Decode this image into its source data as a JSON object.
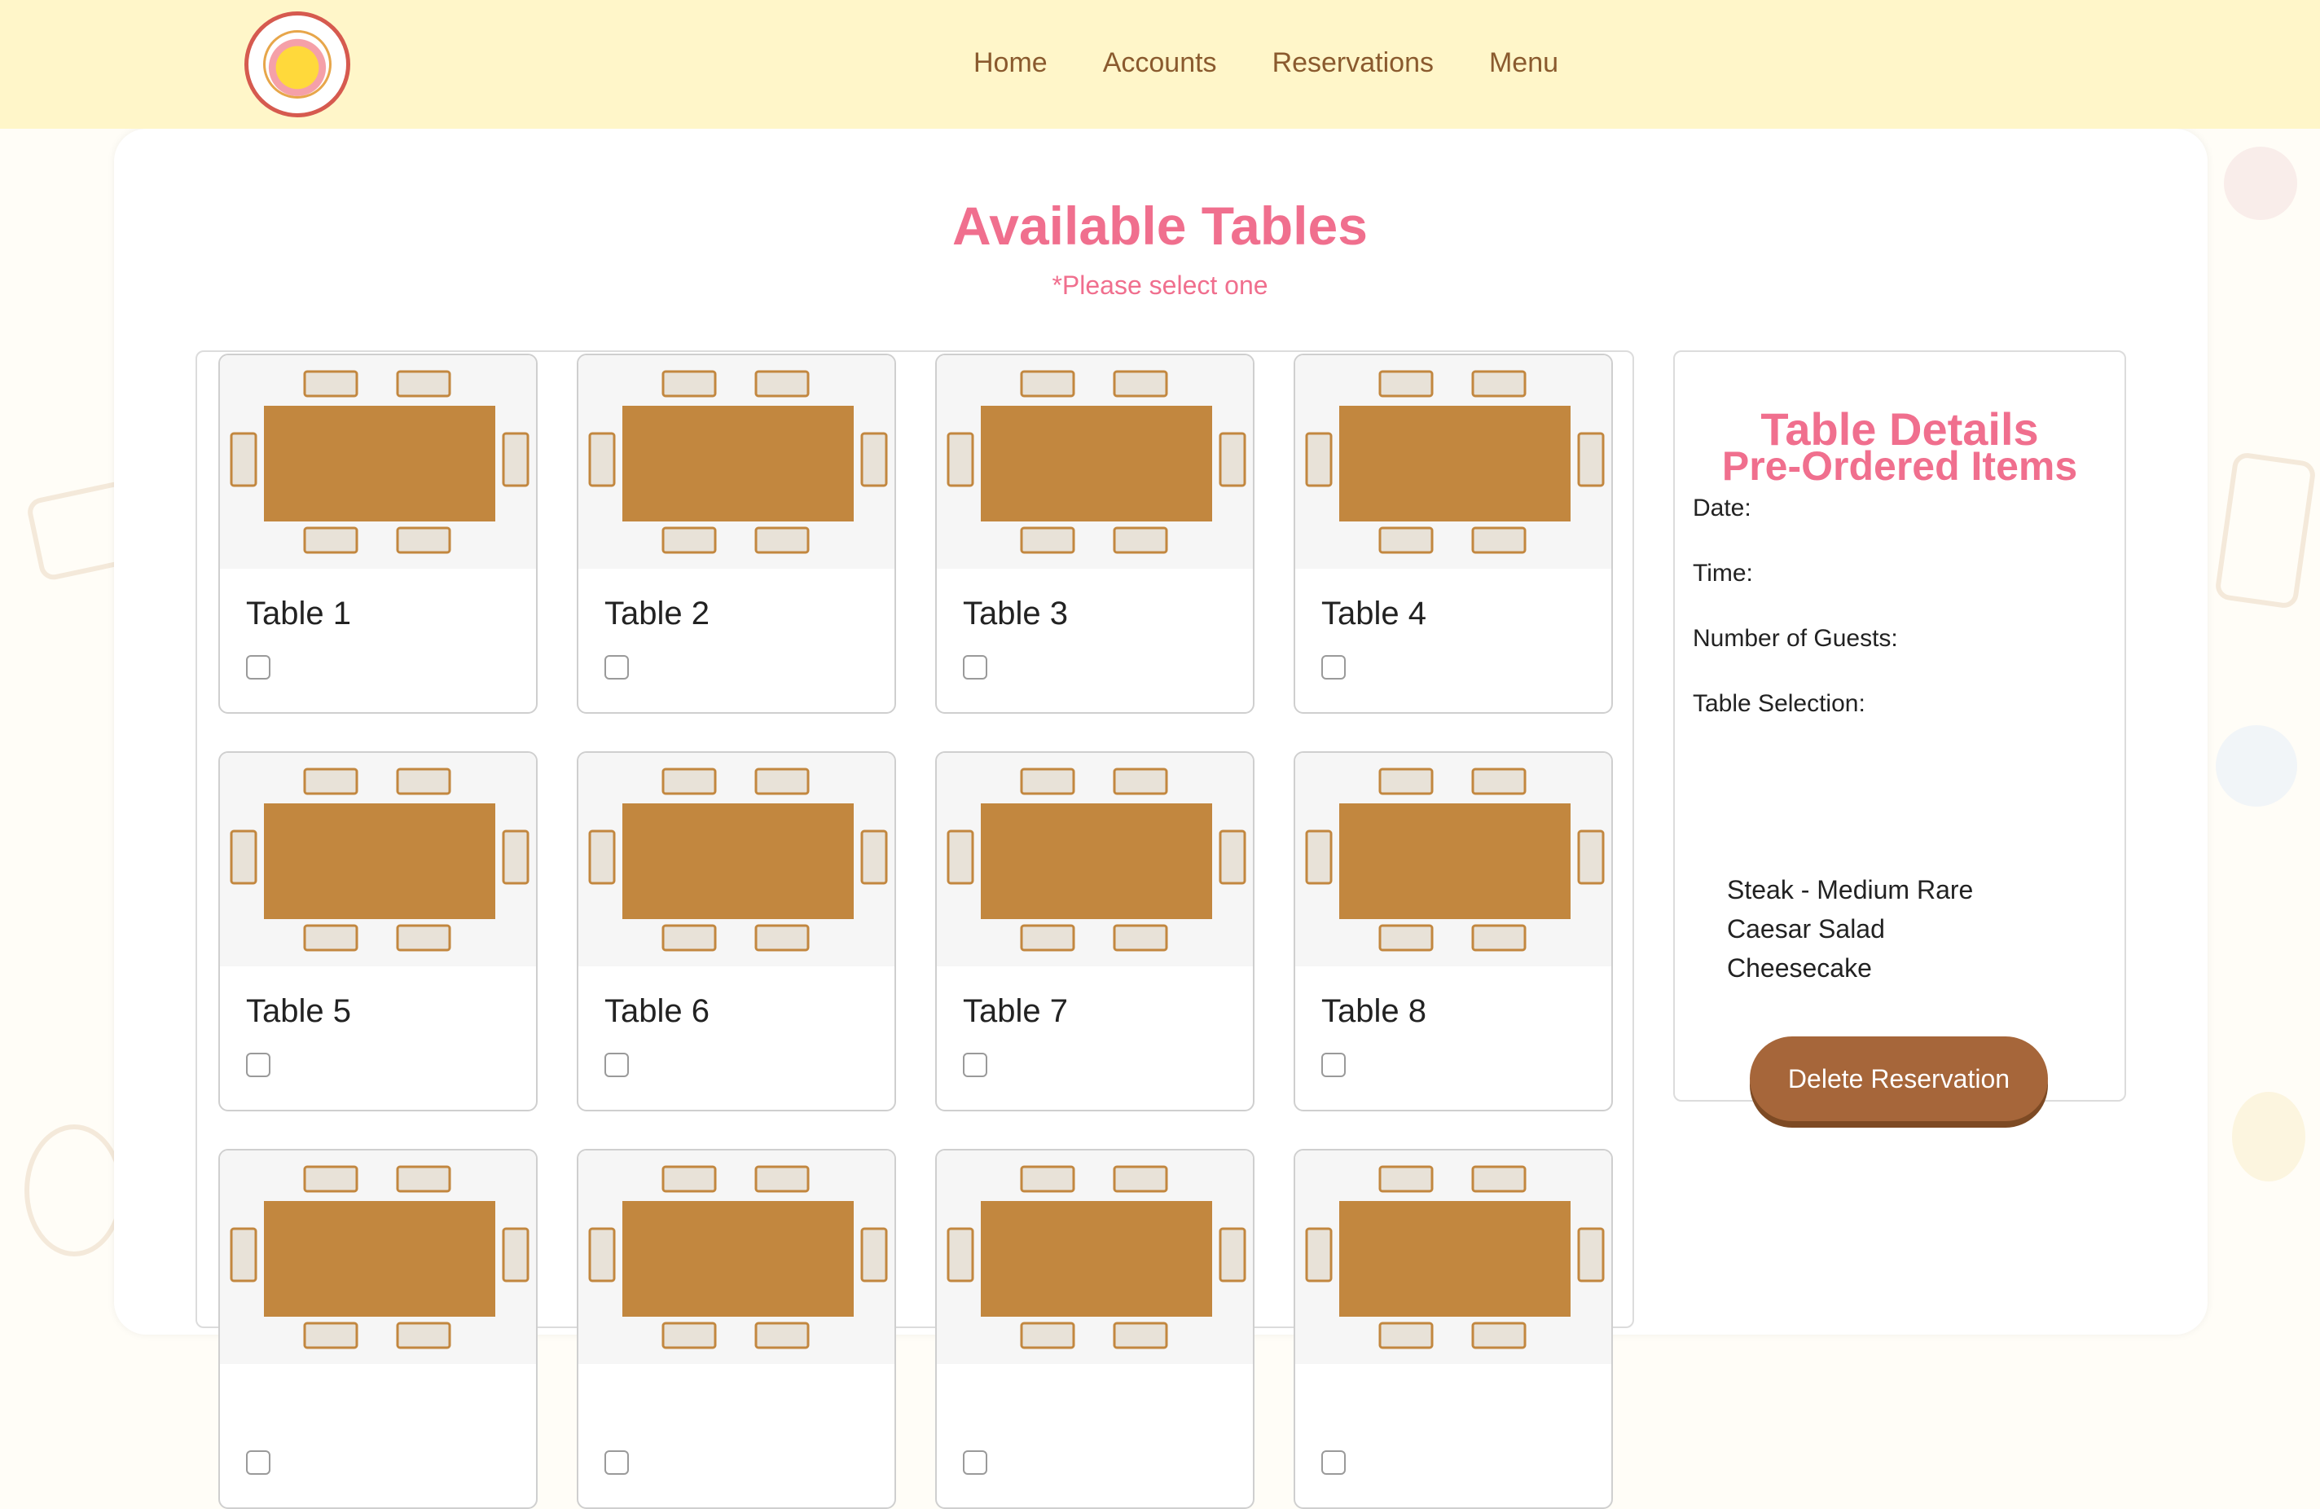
{
  "header": {
    "logo_icon": "pikachu-sweets-logo-icon",
    "nav": [
      {
        "label": "Home"
      },
      {
        "label": "Accounts"
      },
      {
        "label": "Reservations"
      },
      {
        "label": "Menu"
      }
    ]
  },
  "main": {
    "title": "Available Tables",
    "subtitle": "*Please select one",
    "tables": [
      {
        "label": "Table 1",
        "checked": false
      },
      {
        "label": "Table 2",
        "checked": false
      },
      {
        "label": "Table 3",
        "checked": false
      },
      {
        "label": "Table 4",
        "checked": false
      },
      {
        "label": "Table 5",
        "checked": false
      },
      {
        "label": "Table 6",
        "checked": false
      },
      {
        "label": "Table 7",
        "checked": false
      },
      {
        "label": "Table 8",
        "checked": false
      },
      {
        "label": "",
        "checked": false
      },
      {
        "label": "",
        "checked": false
      },
      {
        "label": "",
        "checked": false
      },
      {
        "label": "",
        "checked": false
      }
    ]
  },
  "details": {
    "title": "Table Details",
    "date_label": "Date:",
    "time_label": "Time:",
    "guests_label": "Number of Guests:",
    "selection_label": "Table Selection:",
    "preorder_title": "Pre-Ordered Items",
    "preorder_items": [
      "Steak - Medium Rare",
      "Caesar Salad",
      "Cheesecake"
    ],
    "delete_label": "Delete Reservation"
  },
  "colors": {
    "header_bg": "#fff6c9",
    "accent_pink": "#f06f8e",
    "nav_brown": "#8a5a2e",
    "table_wood": "#c2873f",
    "button_brown": "#a6663a"
  }
}
